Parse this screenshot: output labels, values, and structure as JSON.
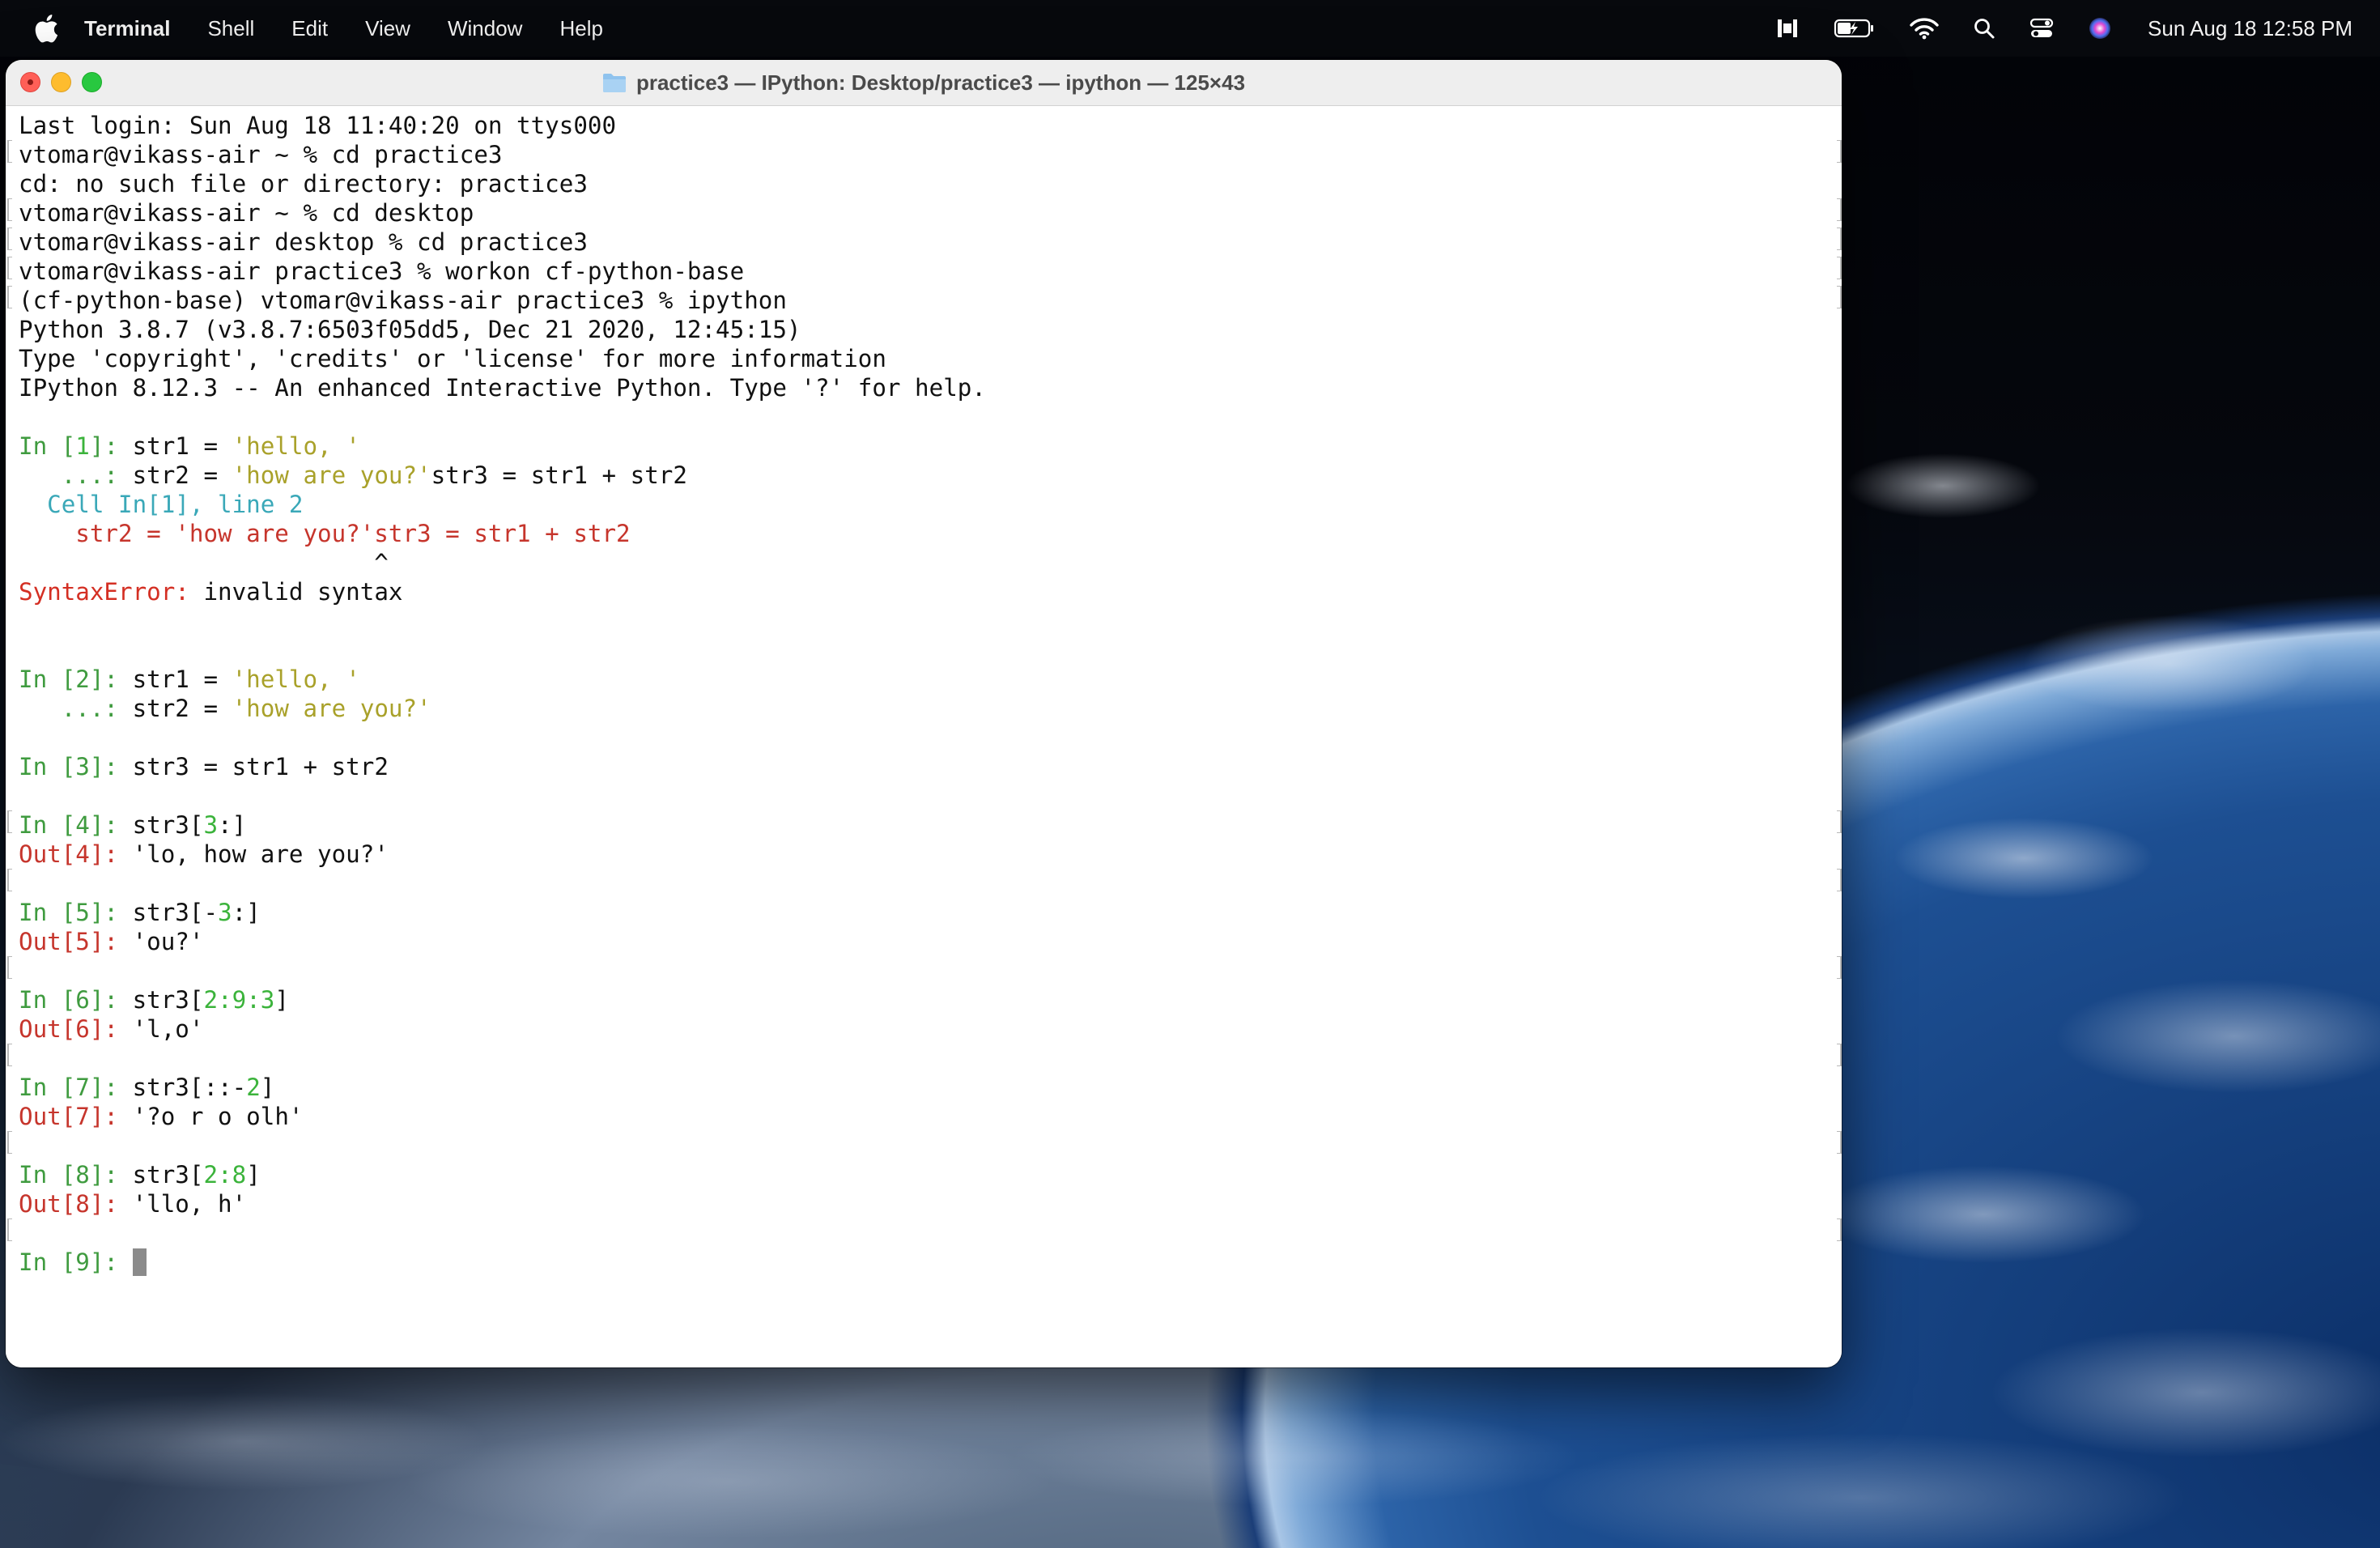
{
  "menubar": {
    "app_name": "Terminal",
    "items": [
      "Shell",
      "Edit",
      "View",
      "Window",
      "Help"
    ],
    "clock": "Sun Aug 18  12:58 PM",
    "status_icons": [
      "dock-pause-icon",
      "battery-charging-icon",
      "wifi-icon",
      "spotlight-search-icon",
      "control-center-icon",
      "siri-icon"
    ]
  },
  "window": {
    "title": "practice3 — IPython: Desktop/practice3 — ipython — 125×43"
  },
  "terminal": {
    "l01": "Last login: Sun Aug 18 11:40:20 on ttys000",
    "l02": "vtomar@vikass-air ~ % cd practice3",
    "l03": "cd: no such file or directory: practice3",
    "l04": "vtomar@vikass-air ~ % cd desktop",
    "l05": "vtomar@vikass-air desktop % cd practice3",
    "l06": "vtomar@vikass-air practice3 % workon cf-python-base",
    "l07": "(cf-python-base) vtomar@vikass-air practice3 % ipython",
    "l08": "Python 3.8.7 (v3.8.7:6503f05dd5, Dec 21 2020, 12:45:15)",
    "l09": "Type 'copyright', 'credits' or 'license' for more information",
    "l10": "IPython 8.12.3 -- An enhanced Interactive Python. Type '?' for help.",
    "in1": {
      "prompt_pre": "In [",
      "num": "1",
      "prompt_post": "]: ",
      "code1": "str1 = ",
      "str1": "'hello, '",
      "cont": "   ...: ",
      "code2": "str2 = ",
      "str2": "'how are you?'",
      "code2b": "str3 = str1 + str2"
    },
    "err": {
      "cell": "  Cell In[1], line 2",
      "src": "    str2 = 'how are you?'str3 = str1 + str2",
      "caret": "                         ^",
      "type": "SyntaxError:",
      "msg": " invalid syntax"
    },
    "in2": {
      "prompt": "In [2]: ",
      "code1": "str1 = ",
      "str1": "'hello, '",
      "cont": "   ...: ",
      "code2": "str2 = ",
      "str2": "'how are you?'"
    },
    "in3": {
      "prompt": "In [3]: ",
      "code": "str3 = str1 + str2"
    },
    "in4": {
      "prompt": "In [4]: ",
      "a": "str3[",
      "n1": "3",
      "b": ":]",
      "out": "Out[4]: ",
      "val": "'lo, how are you?'"
    },
    "in5": {
      "prompt": "In [5]: ",
      "a": "str3[-",
      "n1": "3",
      "b": ":]",
      "out": "Out[5]: ",
      "val": "'ou?'"
    },
    "in6": {
      "prompt": "In [6]: ",
      "a": "str3[",
      "n1": "2",
      "s1": ":",
      "n2": "9",
      "s2": ":",
      "n3": "3",
      "b": "]",
      "out": "Out[6]: ",
      "val": "'l,o'"
    },
    "in7": {
      "prompt": "In [7]: ",
      "a": "str3[::-",
      "n1": "2",
      "b": "]",
      "out": "Out[7]: ",
      "val": "'?o r o olh'"
    },
    "in8": {
      "prompt": "In [8]: ",
      "a": "str3[",
      "n1": "2",
      "s1": ":",
      "n2": "8",
      "b": "]",
      "out": "Out[8]: ",
      "val": "'llo, h'"
    },
    "in9": {
      "prompt": "In [9]: "
    }
  }
}
